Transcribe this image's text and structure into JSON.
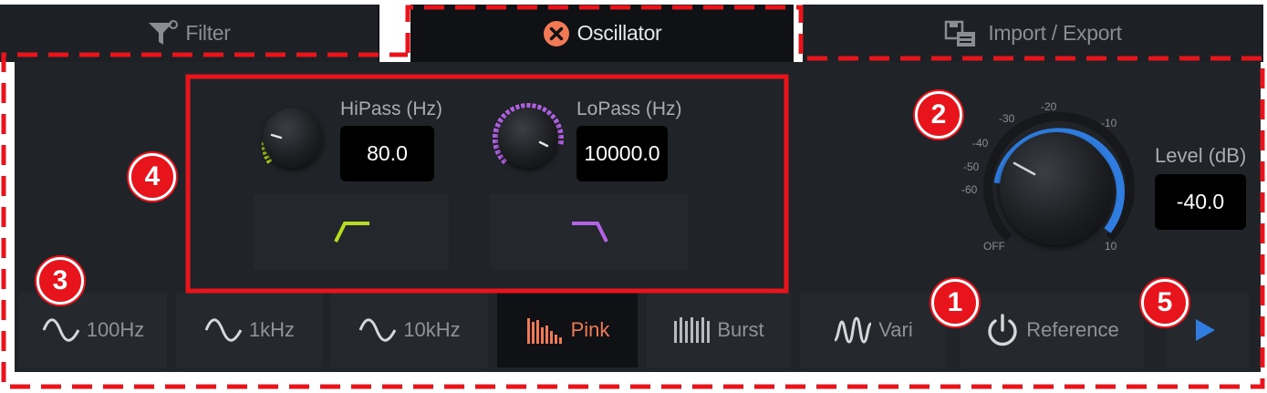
{
  "tabs": {
    "filter": "Filter",
    "oscillator": "Oscillator",
    "import_export": "Import / Export"
  },
  "filters": {
    "hipass": {
      "label": "HiPass (Hz)",
      "value": "80.0",
      "color": "#b6dd1e"
    },
    "lopass": {
      "label": "LoPass (Hz)",
      "value": "10000.0",
      "color": "#b463e6"
    }
  },
  "level": {
    "label": "Level (dB)",
    "value": "-40.0",
    "ticks": [
      "-30",
      "-20",
      "-10",
      "-40",
      "-50",
      "-60",
      "OFF",
      "10"
    ],
    "accent": "#2f7de0"
  },
  "signals": [
    {
      "label": "100Hz",
      "icon": "sine-wave-icon"
    },
    {
      "label": "1kHz",
      "icon": "sine-wave-icon"
    },
    {
      "label": "10kHz",
      "icon": "sine-wave-icon"
    },
    {
      "label": "Pink",
      "icon": "pink-noise-icon",
      "active": true
    },
    {
      "label": "Burst",
      "icon": "burst-icon"
    },
    {
      "label": "Vari",
      "icon": "vari-wave-icon"
    }
  ],
  "reference": {
    "label": "Reference",
    "icon": "power-icon"
  },
  "callouts": [
    "1",
    "2",
    "3",
    "4",
    "5"
  ],
  "colors": {
    "annotation_red": "#e8141b",
    "active_orange": "#f07a55",
    "play_blue": "#2f7de0"
  }
}
